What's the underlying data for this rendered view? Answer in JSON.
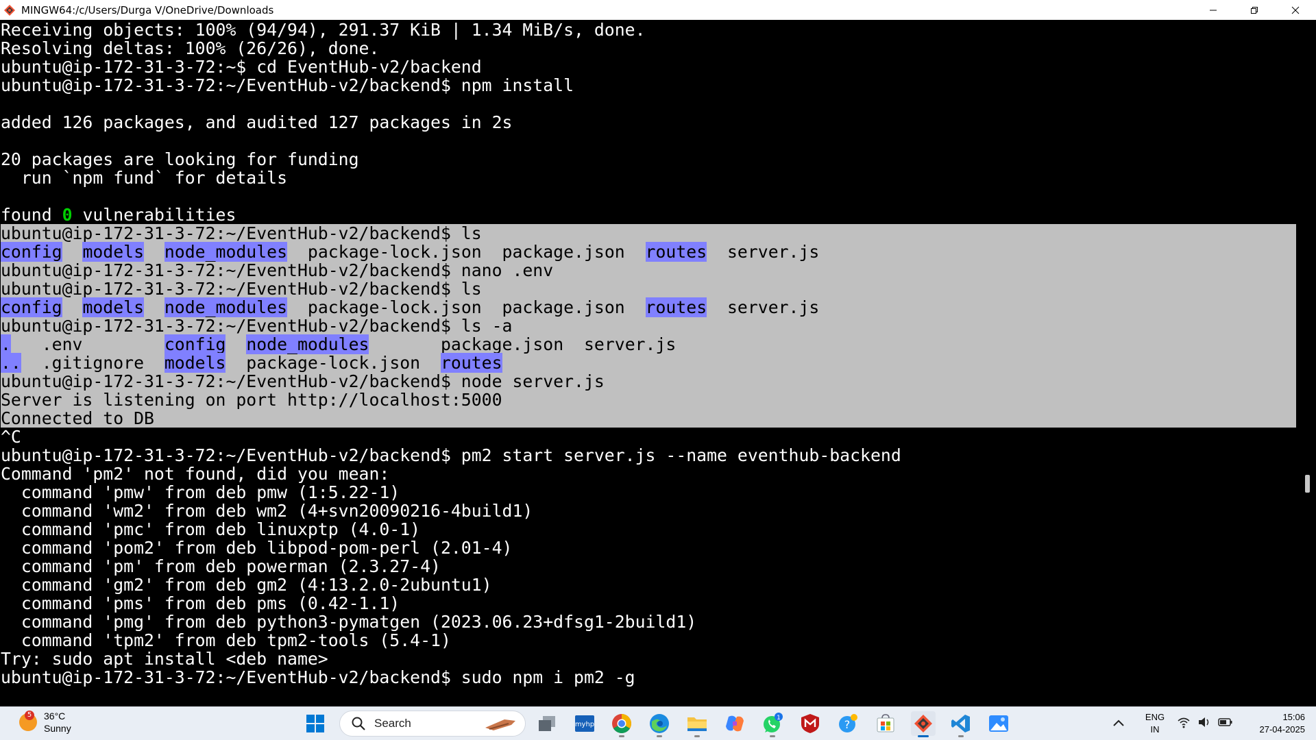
{
  "window": {
    "title": "MINGW64:/c/Users/Durga V/OneDrive/Downloads"
  },
  "terminal": {
    "lines": [
      {
        "segments": [
          {
            "t": "Receiving objects: 100% (94/94), 291.37 KiB | 1.34 MiB/s, done."
          }
        ]
      },
      {
        "segments": [
          {
            "t": "Resolving deltas: 100% (26/26), done."
          }
        ]
      },
      {
        "segments": [
          {
            "t": "ubuntu@ip-172-31-3-72:~$ cd EventHub-v2/backend"
          }
        ]
      },
      {
        "segments": [
          {
            "t": "ubuntu@ip-172-31-3-72:~/EventHub-v2/backend$ npm install"
          }
        ]
      },
      {
        "segments": [
          {
            "t": ""
          }
        ]
      },
      {
        "segments": [
          {
            "t": "added 126 packages, and audited 127 packages in 2s"
          }
        ]
      },
      {
        "segments": [
          {
            "t": ""
          }
        ]
      },
      {
        "segments": [
          {
            "t": "20 packages are looking for funding"
          }
        ]
      },
      {
        "segments": [
          {
            "t": "  run `npm fund` for details"
          }
        ]
      },
      {
        "segments": [
          {
            "t": ""
          }
        ]
      },
      {
        "segments": [
          {
            "t": "found "
          },
          {
            "t": "0",
            "c": "green"
          },
          {
            "t": " vulnerabilities"
          }
        ]
      },
      {
        "sel": true,
        "segments": [
          {
            "t": "ubuntu@ip-172-31-3-72:~/EventHub-v2/backend$ ls"
          }
        ]
      },
      {
        "sel": true,
        "segments": [
          {
            "t": "config",
            "c": "dir"
          },
          {
            "t": "  "
          },
          {
            "t": "models",
            "c": "dir"
          },
          {
            "t": "  "
          },
          {
            "t": "node_modules",
            "c": "dir"
          },
          {
            "t": "  package-lock.json  package.json  "
          },
          {
            "t": "routes",
            "c": "dir"
          },
          {
            "t": "  server.js"
          }
        ]
      },
      {
        "sel": true,
        "segments": [
          {
            "t": "ubuntu@ip-172-31-3-72:~/EventHub-v2/backend$ nano .env"
          }
        ]
      },
      {
        "sel": true,
        "segments": [
          {
            "t": "ubuntu@ip-172-31-3-72:~/EventHub-v2/backend$ ls"
          }
        ]
      },
      {
        "sel": true,
        "segments": [
          {
            "t": "config",
            "c": "dir"
          },
          {
            "t": "  "
          },
          {
            "t": "models",
            "c": "dir"
          },
          {
            "t": "  "
          },
          {
            "t": "node_modules",
            "c": "dir"
          },
          {
            "t": "  package-lock.json  package.json  "
          },
          {
            "t": "routes",
            "c": "dir"
          },
          {
            "t": "  server.js"
          }
        ]
      },
      {
        "sel": true,
        "segments": [
          {
            "t": "ubuntu@ip-172-31-3-72:~/EventHub-v2/backend$ ls -a"
          }
        ]
      },
      {
        "sel": true,
        "segments": [
          {
            "t": ".",
            "c": "dir"
          },
          {
            "t": "   .env        "
          },
          {
            "t": "config",
            "c": "dir"
          },
          {
            "t": "  "
          },
          {
            "t": "node_modules",
            "c": "dir"
          },
          {
            "t": "       package.json  server.js"
          }
        ]
      },
      {
        "sel": true,
        "segments": [
          {
            "t": "..",
            "c": "dir"
          },
          {
            "t": "  .gitignore  "
          },
          {
            "t": "models",
            "c": "dir"
          },
          {
            "t": "  package-lock.json  "
          },
          {
            "t": "routes",
            "c": "dir"
          }
        ]
      },
      {
        "sel": true,
        "segments": [
          {
            "t": "ubuntu@ip-172-31-3-72:~/EventHub-v2/backend$ node server.js"
          }
        ]
      },
      {
        "sel": true,
        "segments": [
          {
            "t": "Server is listening on port http://localhost:5000"
          }
        ]
      },
      {
        "sel": true,
        "segments": [
          {
            "t": "Connected to DB"
          }
        ]
      },
      {
        "segments": [
          {
            "t": "^C"
          }
        ]
      },
      {
        "segments": [
          {
            "t": "ubuntu@ip-172-31-3-72:~/EventHub-v2/backend$ pm2 start server.js --name eventhub-backend"
          }
        ]
      },
      {
        "segments": [
          {
            "t": "Command 'pm2' not found, did you mean:"
          }
        ]
      },
      {
        "segments": [
          {
            "t": "  command 'pmw' from deb pmw (1:5.22-1)"
          }
        ]
      },
      {
        "segments": [
          {
            "t": "  command 'wm2' from deb wm2 (4+svn20090216-4build1)"
          }
        ]
      },
      {
        "segments": [
          {
            "t": "  command 'pmc' from deb linuxptp (4.0-1)"
          }
        ]
      },
      {
        "segments": [
          {
            "t": "  command 'pom2' from deb libpod-pom-perl (2.01-4)"
          }
        ]
      },
      {
        "segments": [
          {
            "t": "  command 'pm' from deb powerman (2.3.27-4)"
          }
        ]
      },
      {
        "segments": [
          {
            "t": "  command 'gm2' from deb gm2 (4:13.2.0-2ubuntu1)"
          }
        ]
      },
      {
        "segments": [
          {
            "t": "  command 'pms' from deb pms (0.42-1.1)"
          }
        ]
      },
      {
        "segments": [
          {
            "t": "  command 'pmg' from deb python3-pymatgen (2023.06.23+dfsg1-2build1)"
          }
        ]
      },
      {
        "segments": [
          {
            "t": "  command 'tpm2' from deb tpm2-tools (5.4-1)"
          }
        ]
      },
      {
        "segments": [
          {
            "t": "Try: sudo apt install <deb name>"
          }
        ]
      },
      {
        "segments": [
          {
            "t": "ubuntu@ip-172-31-3-72:~/EventHub-v2/backend$ sudo npm i pm2 -g"
          }
        ]
      }
    ]
  },
  "taskbar": {
    "weather": {
      "badge": "5",
      "temp": "36°C",
      "condition": "Sunny"
    },
    "search_label": "Search",
    "pinned": [
      {
        "name": "start-button",
        "icon": "windows-logo-icon"
      },
      {
        "name": "task-view",
        "icon": "task-view-icon"
      },
      {
        "name": "hp-app",
        "icon": "myhp-icon"
      },
      {
        "name": "chrome",
        "icon": "chrome-icon"
      },
      {
        "name": "edge",
        "icon": "edge-icon"
      },
      {
        "name": "file-explorer",
        "icon": "folder-icon"
      },
      {
        "name": "copilot",
        "icon": "copilot-icon"
      },
      {
        "name": "whatsapp",
        "icon": "whatsapp-icon",
        "badge": "1"
      },
      {
        "name": "mcafee",
        "icon": "mcafee-icon"
      },
      {
        "name": "help",
        "icon": "help-icon"
      },
      {
        "name": "ms-store",
        "icon": "store-icon"
      },
      {
        "name": "git-bash",
        "icon": "git-bash-icon",
        "active": true
      },
      {
        "name": "vscode",
        "icon": "vscode-icon"
      },
      {
        "name": "photos",
        "icon": "photos-icon"
      }
    ],
    "lang": {
      "line1": "ENG",
      "line2": "IN"
    },
    "clock": {
      "time": "15:06",
      "date": "27-04-2025"
    }
  },
  "colors": {
    "terminal_bg": "#000000",
    "selection_bg": "#c0c0c0",
    "dir_highlight": "#8080ff",
    "green_text": "#00d000",
    "taskbar_bg": "#e9eef5"
  }
}
